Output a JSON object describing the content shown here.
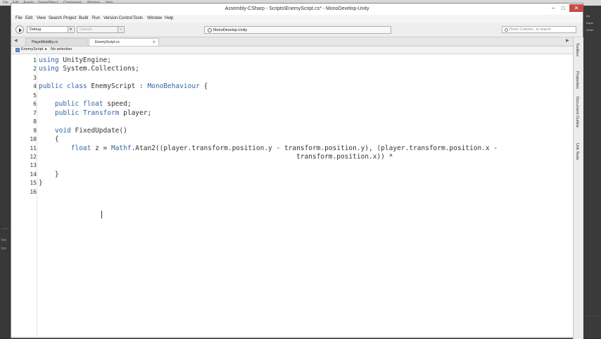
{
  "unity_menu": [
    "File",
    "Edit",
    "Assets",
    "GameObject",
    "Component",
    "Window",
    "Help"
  ],
  "window": {
    "title": "Assembly-CSharp - Scripts\\EnemyScript.cs* - MonoDevelop-Unity",
    "minimize": "–",
    "maximize": "□",
    "close": "✕"
  },
  "menu": [
    "File",
    "Edit",
    "View",
    "Search",
    "Project",
    "Build",
    "Run",
    "Version Control",
    "Tools",
    "Window",
    "Help"
  ],
  "toolbar": {
    "config": "Debug",
    "platform": "Default",
    "status": "MonoDevelop-Unity",
    "search_placeholder": "Press 'Control+,' to search"
  },
  "tabs": [
    {
      "label": "PlayerMobility.cs",
      "active": false
    },
    {
      "label": "EnemyScript.cs",
      "active": true
    }
  ],
  "path": {
    "class": "EnemyScript",
    "member": "No selection"
  },
  "code": [
    [
      {
        "t": "using",
        "k": 1
      },
      {
        "t": " UnityEngine;"
      }
    ],
    [
      {
        "t": "using",
        "k": 1
      },
      {
        "t": " System.Collections;"
      }
    ],
    [],
    [
      {
        "t": "public class",
        "k": 1
      },
      {
        "t": " EnemyScript : "
      },
      {
        "t": "MonoBehaviour",
        "k": 1
      },
      {
        "t": " {"
      }
    ],
    [],
    [
      {
        "t": "    public float",
        "k": 1
      },
      {
        "t": " speed;"
      }
    ],
    [
      {
        "t": "    public",
        "k": 1
      },
      {
        "t": " "
      },
      {
        "t": "Transform",
        "k": 1
      },
      {
        "t": " player;"
      }
    ],
    [],
    [
      {
        "t": "    void",
        "k": 1
      },
      {
        "t": " FixedUpdate()"
      }
    ],
    [
      {
        "t": "    {"
      }
    ],
    [
      {
        "t": "        float",
        "k": 1
      },
      {
        "t": " z = "
      },
      {
        "t": "Mathf",
        "k": 1
      },
      {
        "t": ".Atan2((player.transform.position.y - transform.position.y), (player.transform.position.x -"
      }
    ],
    [
      {
        "t": "                                                                transform.position.x)) *"
      }
    ],
    [],
    [
      {
        "t": "    }"
      }
    ],
    [
      {
        "t": "}"
      }
    ],
    []
  ],
  "right_pads": [
    "Toolbox",
    "Properties",
    "Document Outline",
    "Unit Tests"
  ],
  "left_dock": [
    "Ins",
    "Ins"
  ],
  "right_dock": [
    "Ins",
    "Inspe",
    "Order"
  ],
  "colors": {
    "keyword": "#3364a4",
    "text": "#333333",
    "close": "#c74b4b"
  }
}
